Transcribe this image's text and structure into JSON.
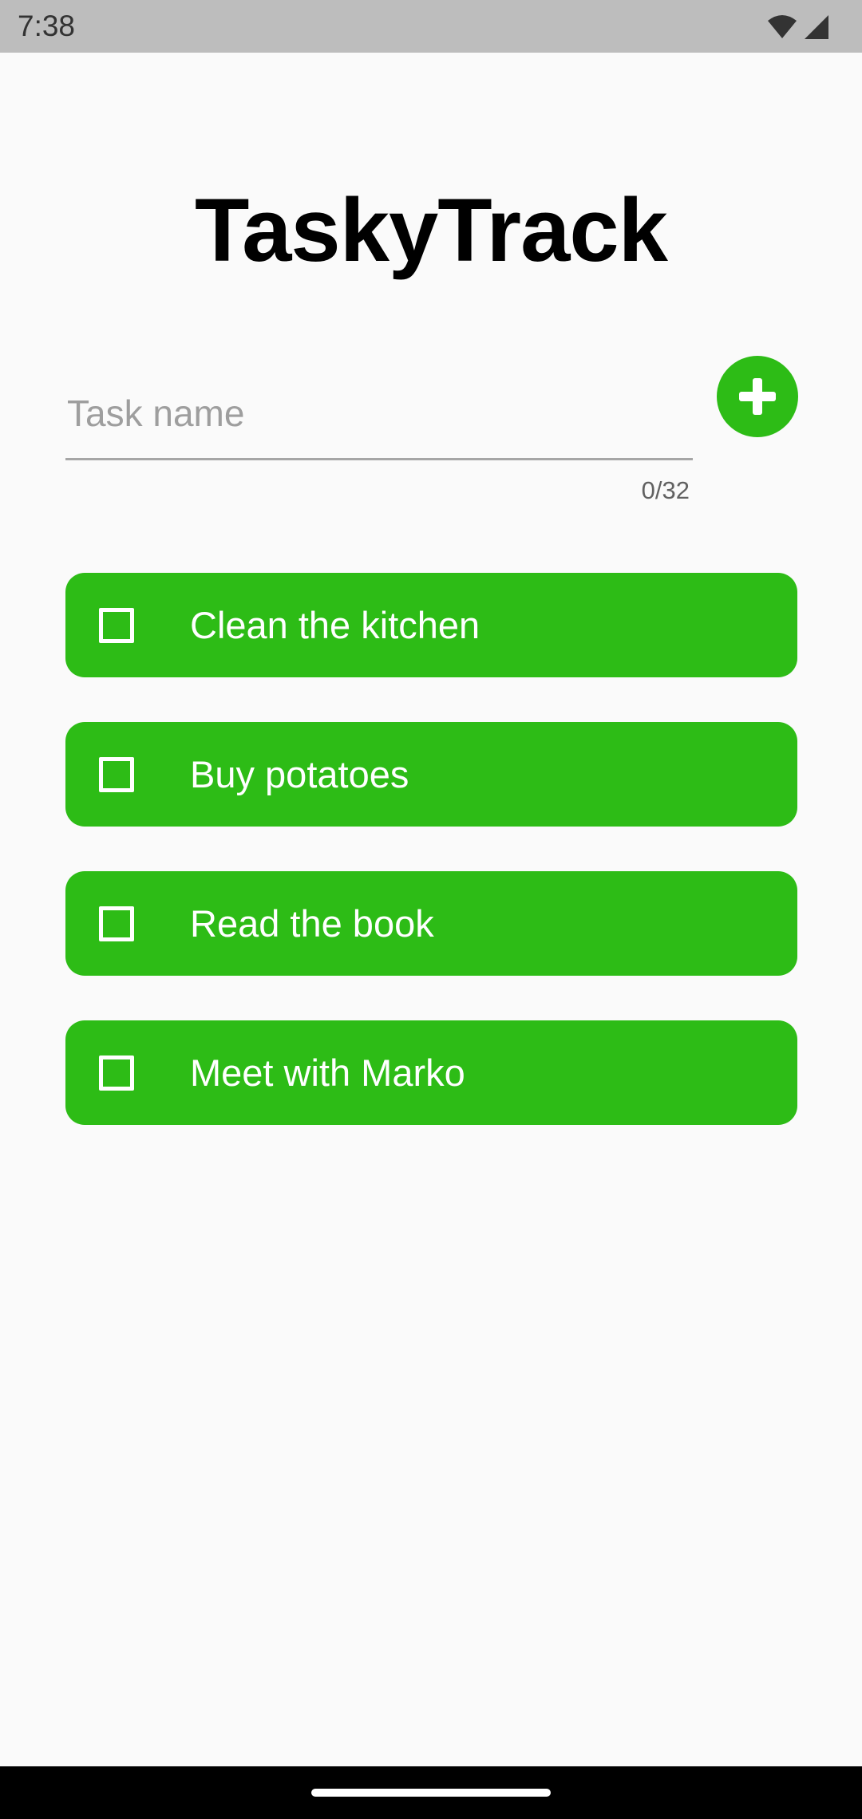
{
  "status_bar": {
    "time": "7:38",
    "icons": [
      "wifi-icon",
      "cellular-signal-icon"
    ],
    "background": "#bdbdbd"
  },
  "app": {
    "title": "TaskyTrack"
  },
  "task_input": {
    "placeholder": "Task name",
    "value": "",
    "counter": "0/32"
  },
  "add_button": {
    "icon": "plus-icon",
    "color": "#2dbc16"
  },
  "tasks": [
    {
      "label": "Clean the kitchen",
      "checked": false
    },
    {
      "label": "Buy potatoes",
      "checked": false
    },
    {
      "label": "Read the book",
      "checked": false
    },
    {
      "label": "Meet with Marko",
      "checked": false
    }
  ],
  "colors": {
    "accent": "#2dbc16",
    "background": "#fafafa",
    "task_text": "#ffffff",
    "nav_bar": "#000000"
  }
}
